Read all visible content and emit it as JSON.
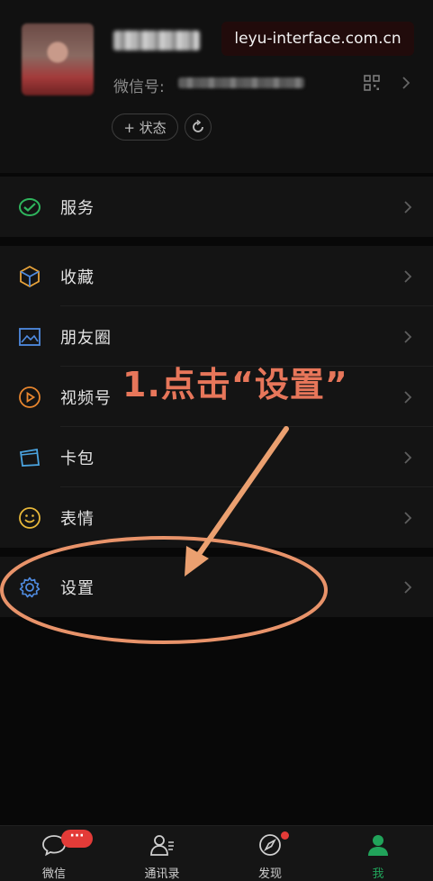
{
  "watermark": "leyu-interface.com.cn",
  "profile": {
    "wxid_label": "微信号:",
    "status_button": "+ 状态"
  },
  "menu": {
    "service": "服务",
    "items": [
      "收藏",
      "朋友圈",
      "视频号",
      "卡包",
      "表情"
    ],
    "settings": "设置"
  },
  "annotation": "1.点击“设置”",
  "colors": {
    "annotation": "#e7765a",
    "accent": "#21a35a",
    "badge": "#e33b38"
  },
  "tabs": [
    {
      "label": "微信",
      "icon": "chat-bubble-icon",
      "badge": "···"
    },
    {
      "label": "通讯录",
      "icon": "contacts-icon"
    },
    {
      "label": "发现",
      "icon": "compass-icon",
      "dot": true
    },
    {
      "label": "我",
      "icon": "person-icon",
      "active": true
    }
  ]
}
